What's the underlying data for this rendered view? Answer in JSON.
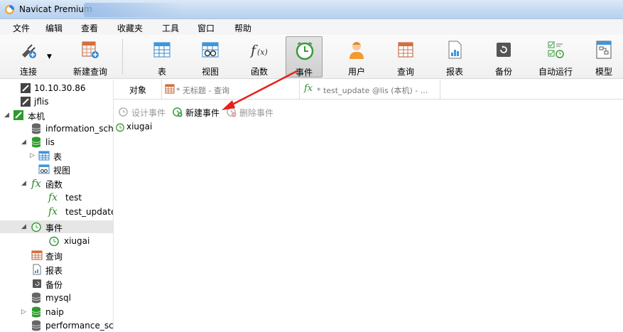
{
  "window": {
    "title": "Navicat Premium"
  },
  "menu": [
    "文件",
    "编辑",
    "查看",
    "收藏夹",
    "工具",
    "窗口",
    "帮助"
  ],
  "toolbar": {
    "connect": "连接",
    "new_query": "新建查询",
    "table": "表",
    "view": "视图",
    "function": "函数",
    "event": "事件",
    "user": "用户",
    "query": "查询",
    "report": "报表",
    "backup": "备份",
    "automation": "自动运行",
    "model": "模型"
  },
  "tree": {
    "conn1": "10.10.30.86",
    "conn2": "jflis",
    "local": "本机",
    "db_info": "information_sche",
    "db_lis": "lis",
    "tables": "表",
    "views": "视图",
    "functions": "函数",
    "fn_test": "test",
    "fn_test_update": "test_update",
    "events": "事件",
    "ev_xiugai": "xiugai",
    "queries": "查询",
    "reports": "报表",
    "backups": "备份",
    "db_mysql": "mysql",
    "db_naip": "naip",
    "db_perf": "performance_scl"
  },
  "tabs": {
    "objects": "对象",
    "untitled_query": "* 无标题 - 查询",
    "test_update": "* test_update @lis (本机) - ..."
  },
  "subtoolbar": {
    "design_event": "设计事件",
    "new_event": "新建事件",
    "delete_event": "删除事件"
  },
  "events_list": [
    "xiugai"
  ]
}
